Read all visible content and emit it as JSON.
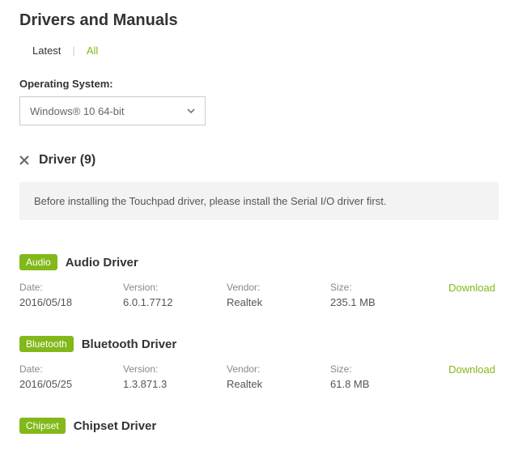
{
  "header": {
    "title": "Drivers and Manuals"
  },
  "tabs": {
    "latest": "Latest",
    "all": "All",
    "active": "all"
  },
  "os": {
    "label": "Operating System:",
    "selected": "Windows® 10 64-bit"
  },
  "section": {
    "title": "Driver (9)"
  },
  "notice": {
    "text": "Before installing the Touchpad driver, please install the Serial I/O driver first."
  },
  "meta_labels": {
    "date": "Date:",
    "version": "Version:",
    "vendor": "Vendor:",
    "size": "Size:",
    "download": "Download"
  },
  "drivers": [
    {
      "category": "Audio",
      "name": "Audio Driver",
      "date": "2016/05/18",
      "version": "6.0.1.7712",
      "vendor": "Realtek",
      "size": "235.1 MB"
    },
    {
      "category": "Bluetooth",
      "name": "Bluetooth Driver",
      "date": "2016/05/25",
      "version": "1.3.871.3",
      "vendor": "Realtek",
      "size": "61.8 MB"
    },
    {
      "category": "Chipset",
      "name": "Chipset Driver",
      "date": "",
      "version": "",
      "vendor": "",
      "size": ""
    }
  ]
}
